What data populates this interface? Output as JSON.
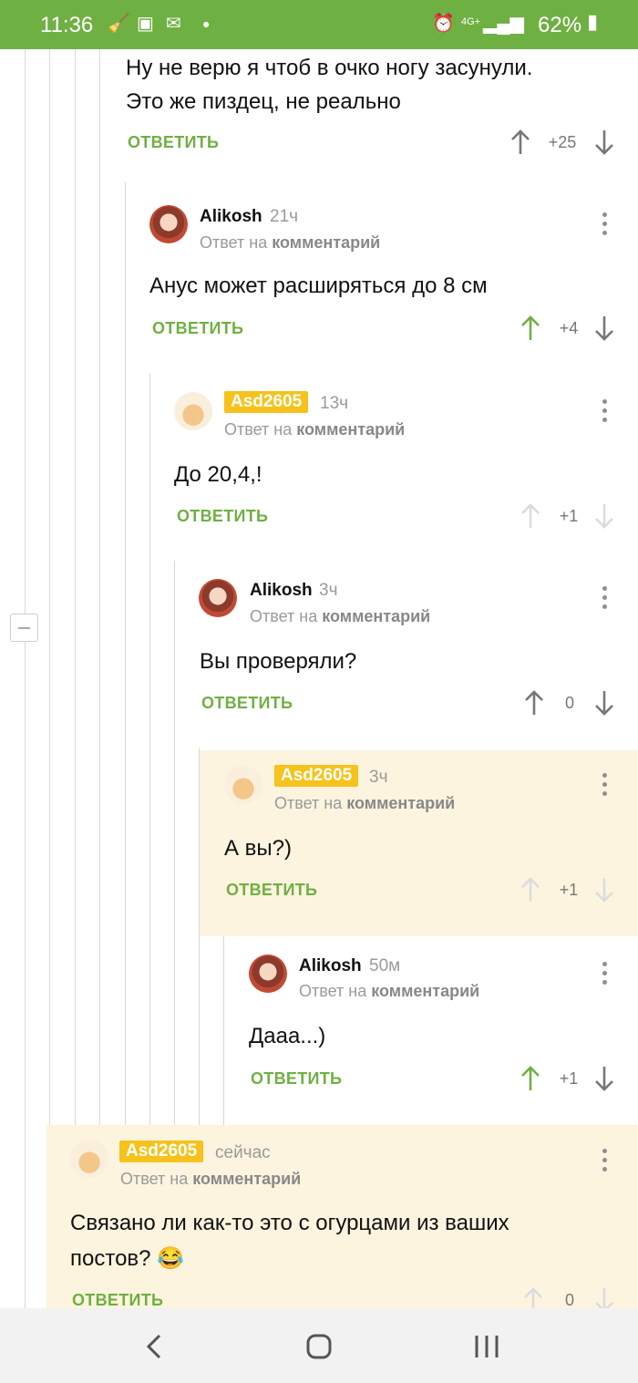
{
  "status_bar": {
    "time": "11:36",
    "network": "4G+",
    "battery": "62%"
  },
  "colors": {
    "accent": "#6fb043",
    "badge": "#f6c21b",
    "highlight": "#fcf4df"
  },
  "top_comment": {
    "text_lines": [
      "Ну не верю я чтоб в очко ногу засунули.",
      "Это же пиздец, не реально"
    ],
    "reply_label": "ОТВЕТИТЬ",
    "score": "+25"
  },
  "comments": [
    {
      "author": "Alikosh",
      "time": "21ч",
      "reply_prefix": "Ответ на",
      "reply_target": "комментарий",
      "text": "Анус может расширяться до 8 см",
      "reply_label": "ОТВЕТИТЬ",
      "score": "+4",
      "vote": "up"
    },
    {
      "author": "Asd2605",
      "time": "13ч",
      "reply_prefix": "Ответ на",
      "reply_target": "комментарий",
      "text": "До 20,4,!",
      "reply_label": "ОТВЕТИТЬ",
      "score": "+1",
      "vote": "none"
    },
    {
      "author": "Alikosh",
      "time": "3ч",
      "reply_prefix": "Ответ на",
      "reply_target": "комментарий",
      "text": "Вы проверяли?",
      "reply_label": "ОТВЕТИТЬ",
      "score": "0",
      "vote": "neutral"
    },
    {
      "author": "Asd2605",
      "time": "3ч",
      "reply_prefix": "Ответ на",
      "reply_target": "комментарий",
      "text": "А вы?)",
      "reply_label": "ОТВЕТИТЬ",
      "score": "+1",
      "vote": "none"
    },
    {
      "author": "Alikosh",
      "time": "50м",
      "reply_prefix": "Ответ на",
      "reply_target": "комментарий",
      "text": "Дааа...)",
      "reply_label": "ОТВЕТИТЬ",
      "score": "+1",
      "vote": "up"
    },
    {
      "author": "Asd2605",
      "time": "сейчас",
      "reply_prefix": "Ответ на",
      "reply_target": "комментарий",
      "text_lines": [
        "Связано ли как-то это с огурцами из ваших",
        "постов? 😂"
      ],
      "reply_label": "ОТВЕТИТЬ",
      "score": "0",
      "vote": "none"
    }
  ]
}
